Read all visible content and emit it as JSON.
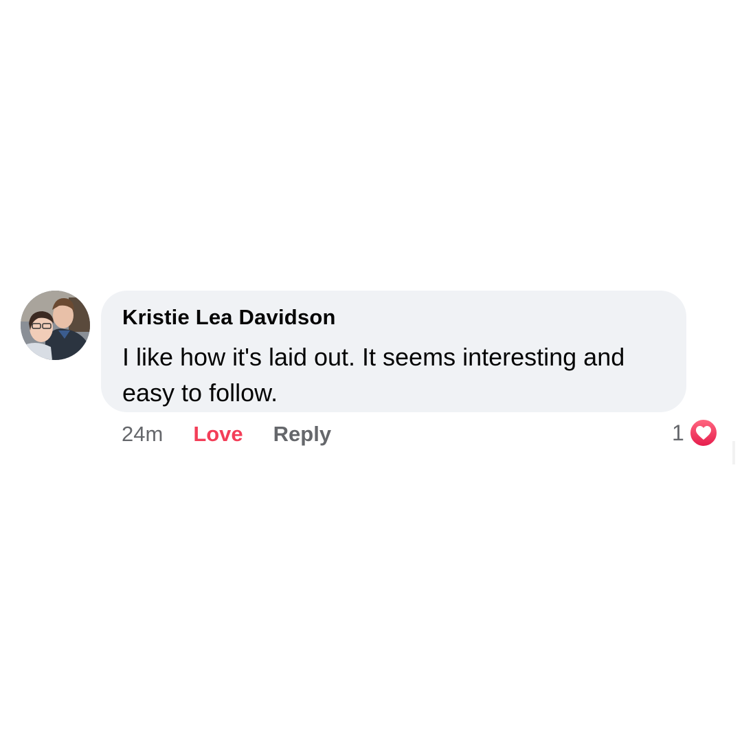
{
  "comment": {
    "author": "Kristie Lea Davidson",
    "text": "I like how it's laid out. It seems interesting and easy to follow.",
    "avatar_icon": "profile-photo-couple",
    "bubble_color": "#f0f2f5"
  },
  "actions": {
    "time": "24m",
    "love_label": "Love",
    "reply_label": "Reply",
    "love_color": "#f33e58"
  },
  "reactions": {
    "count": "1",
    "icon": "heart-icon",
    "color": "#f33e58"
  }
}
